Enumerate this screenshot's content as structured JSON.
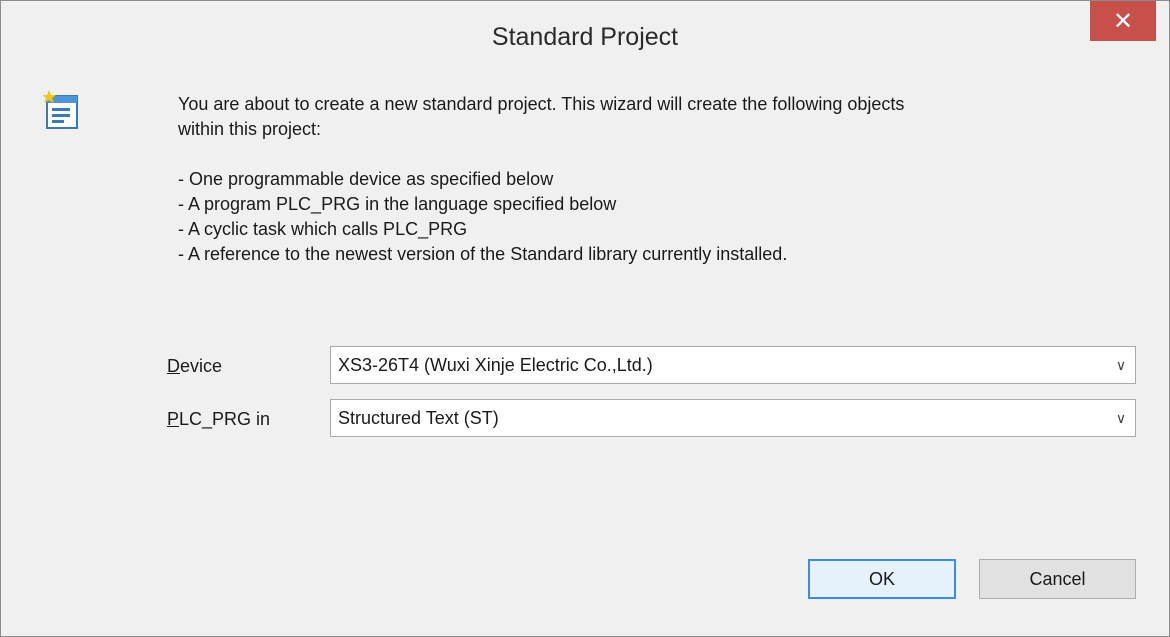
{
  "window": {
    "title": "Standard Project",
    "close_glyph": "✕"
  },
  "icon": {
    "name": "wizard-project-icon"
  },
  "message": {
    "line1": "You are about to create a new standard project. This wizard will create the following objects",
    "line2": "within this project:",
    "items": [
      "- One programmable device as specified below",
      "- A program PLC_PRG in the language specified below",
      "- A cyclic task which calls PLC_PRG",
      "- A reference to the newest version of the Standard library currently installed."
    ]
  },
  "device": {
    "label_access": "D",
    "label_rest": "evice",
    "value": "XS3-26T4 (Wuxi Xinje Electric Co.,Ltd.)"
  },
  "plc_prg": {
    "label_access": "P",
    "label_rest": "LC_PRG in",
    "value": "Structured Text (ST)"
  },
  "buttons": {
    "ok": "OK",
    "cancel": "Cancel"
  },
  "dropdown_glyph": "∨"
}
